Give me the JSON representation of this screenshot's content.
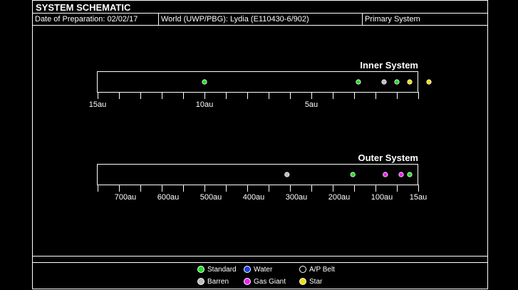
{
  "header": {
    "title": "SYSTEM SCHEMATIC",
    "date_label": "Date of Preparation: 02/02/17",
    "world_label": "World (UWP/PBG): Lydia (E110430-6/902)",
    "system_label": "Primary System"
  },
  "colors": {
    "standard": "#22dd22",
    "water": "#1f3fe0",
    "belt": "#000000",
    "barren": "#bbbbbb",
    "gas_giant": "#ee22ee",
    "star": "#eedd11"
  },
  "inner": {
    "title": "Inner System",
    "axis_min_au": 0,
    "axis_max_au": 15,
    "tick_labels": [
      {
        "au": 15,
        "text": "15au"
      },
      {
        "au": 10,
        "text": "10au"
      },
      {
        "au": 5,
        "text": "5au"
      }
    ],
    "bodies": [
      {
        "au": 10.0,
        "type": "standard"
      },
      {
        "au": 2.8,
        "type": "standard"
      },
      {
        "au": 1.6,
        "type": "barren"
      },
      {
        "au": 1.0,
        "type": "standard"
      },
      {
        "au": 0.4,
        "type": "star"
      },
      {
        "au": -0.5,
        "type": "star"
      }
    ]
  },
  "outer": {
    "title": "Outer System",
    "axis_min_au": 15,
    "axis_max_au": 765,
    "tick_labels": [
      {
        "au": 700,
        "text": "700au"
      },
      {
        "au": 600,
        "text": "600au"
      },
      {
        "au": 500,
        "text": "500au"
      },
      {
        "au": 400,
        "text": "400au"
      },
      {
        "au": 300,
        "text": "300au"
      },
      {
        "au": 200,
        "text": "200au"
      },
      {
        "au": 100,
        "text": "100au"
      },
      {
        "au": 15,
        "text": "15au"
      }
    ],
    "bodies": [
      {
        "au": 322,
        "type": "barren"
      },
      {
        "au": 168,
        "type": "standard"
      },
      {
        "au": 92,
        "type": "gas_giant"
      },
      {
        "au": 55,
        "type": "gas_giant"
      },
      {
        "au": 35,
        "type": "standard"
      }
    ]
  },
  "legend": [
    {
      "key": "standard",
      "label": "Standard"
    },
    {
      "key": "water",
      "label": "Water"
    },
    {
      "key": "belt",
      "label": "A/P Belt"
    },
    {
      "key": "barren",
      "label": "Barren"
    },
    {
      "key": "gas_giant",
      "label": "Gas Giant"
    },
    {
      "key": "star",
      "label": "Star"
    }
  ]
}
